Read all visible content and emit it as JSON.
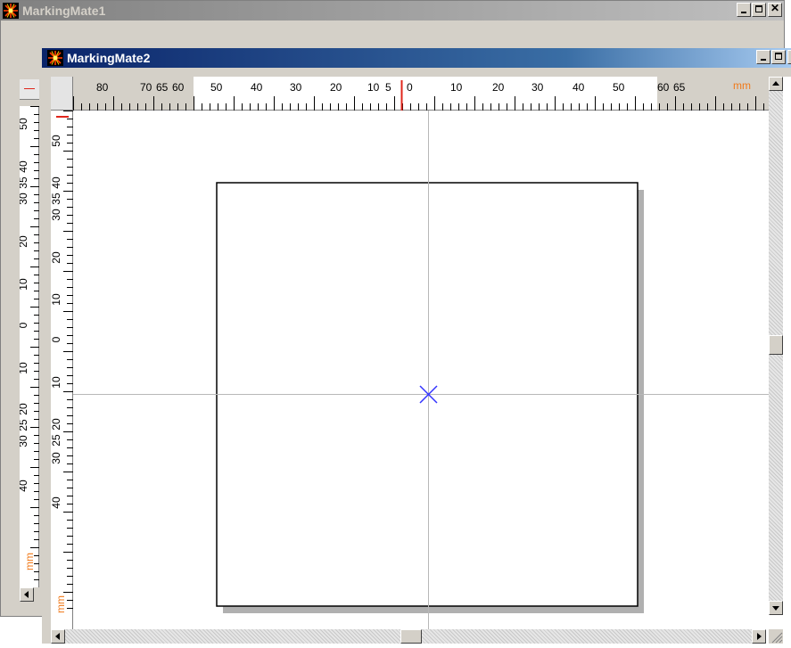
{
  "window1": {
    "title": "MarkingMate1",
    "vruler": {
      "labels": [
        "50",
        "40",
        "35",
        "30",
        "20",
        "10",
        "0",
        "10",
        "20",
        "25",
        "30",
        "40"
      ],
      "unit": "mm"
    }
  },
  "window2": {
    "title": "MarkingMate2",
    "hruler": {
      "labels": [
        "80",
        "70",
        "65",
        "60",
        "50",
        "40",
        "30",
        "20",
        "10",
        "5",
        "0",
        "10",
        "20",
        "30",
        "40",
        "50",
        "60",
        "65"
      ],
      "unit": "mm"
    },
    "vruler": {
      "labels": [
        "50",
        "40",
        "35",
        "30",
        "20",
        "10",
        "0",
        "10",
        "20",
        "25",
        "30",
        "40"
      ],
      "unit": "mm"
    }
  },
  "colors": {
    "active_title": "#0a246a",
    "inactive_title": "#808080",
    "ruler_unit": "#f07a1b",
    "center_marker": "#3333ff",
    "ruler_indicator": "#e0261b"
  },
  "icons": [
    "app-icon",
    "minimize-icon",
    "maximize-icon",
    "close-icon",
    "arrow-up-icon",
    "arrow-down-icon",
    "arrow-left-icon",
    "arrow-right-icon",
    "center-cross-icon",
    "size-grip-icon"
  ]
}
